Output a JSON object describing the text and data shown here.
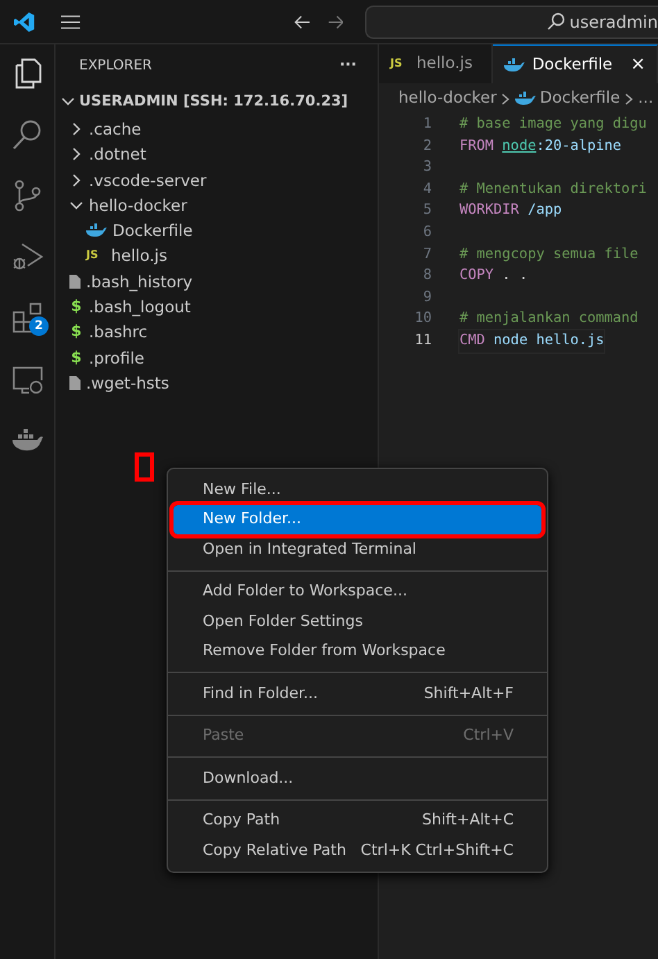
{
  "title_bar": {
    "search": "useradmin"
  },
  "activity_bar": [
    {
      "kind": "files",
      "selected": true
    },
    {
      "kind": "search",
      "selected": false
    },
    {
      "kind": "scm",
      "selected": false
    },
    {
      "kind": "debug",
      "selected": false
    },
    {
      "kind": "extensions",
      "selected": false,
      "badge": "2"
    },
    {
      "kind": "remote",
      "selected": false
    },
    {
      "kind": "docker",
      "selected": false
    }
  ],
  "sidebar": {
    "title": "EXPLORER",
    "more": "···",
    "root": {
      "label": "USERADMIN [SSH: 172.16.70.23]",
      "expanded": true,
      "children": [
        {
          "label": ".cache",
          "kind": "folder",
          "expanded": false
        },
        {
          "label": ".dotnet",
          "kind": "folder",
          "expanded": false
        },
        {
          "label": ".vscode-server",
          "kind": "folder",
          "expanded": false
        },
        {
          "label": "hello-docker",
          "kind": "folder",
          "expanded": true,
          "children": [
            {
              "label": "Dockerfile",
              "kind": "docker"
            },
            {
              "label": "hello.js",
              "kind": "js",
              "icon_text": "JS"
            }
          ]
        },
        {
          "label": ".bash_history",
          "kind": "plain"
        },
        {
          "label": ".bash_logout",
          "kind": "shell",
          "icon_text": "$"
        },
        {
          "label": ".bashrc",
          "kind": "shell",
          "icon_text": "$"
        },
        {
          "label": ".profile",
          "kind": "shell",
          "icon_text": "$"
        },
        {
          "label": ".wget-hsts",
          "kind": "plain"
        }
      ]
    }
  },
  "tabs": [
    {
      "label": "hello.js",
      "kind": "js",
      "icon_text": "JS",
      "selected": false
    },
    {
      "label": "Dockerfile",
      "kind": "docker",
      "selected": true,
      "close": "×"
    }
  ],
  "breadcrumbs": [
    {
      "label": "hello-docker",
      "kind": "folder"
    },
    {
      "label": "Dockerfile",
      "kind": "docker"
    },
    {
      "label": "...",
      "kind": "more"
    }
  ],
  "code": [
    {
      "number": "1",
      "current": false,
      "tokens": [
        {
          "text": "# base image yang digu",
          "kind": "comment"
        }
      ]
    },
    {
      "number": "2",
      "current": false,
      "tokens": [
        {
          "text": "FROM ",
          "kind": "keyword"
        },
        {
          "text": "node",
          "kind": "image"
        },
        {
          "text": ":20-alpine",
          "kind": "variable"
        }
      ]
    },
    {
      "number": "3",
      "current": false
    },
    {
      "number": "4",
      "current": false,
      "tokens": [
        {
          "text": "# Menentukan direktori",
          "kind": "comment"
        }
      ]
    },
    {
      "number": "5",
      "current": false,
      "tokens": [
        {
          "text": "WORKDIR",
          "kind": "keyword"
        },
        {
          "text": " /app",
          "kind": "variable"
        }
      ]
    },
    {
      "number": "6",
      "current": false
    },
    {
      "number": "7",
      "current": false,
      "tokens": [
        {
          "text": "# mengcopy semua file",
          "kind": "comment"
        }
      ]
    },
    {
      "number": "8",
      "current": false,
      "tokens": [
        {
          "text": "COPY",
          "kind": "keyword"
        },
        {
          "text": " . .",
          "kind": "plain"
        }
      ]
    },
    {
      "number": "9",
      "current": false
    },
    {
      "number": "10",
      "current": false,
      "tokens": [
        {
          "text": "# menjalankan command",
          "kind": "comment"
        }
      ]
    },
    {
      "number": "11",
      "current": true,
      "tokens": [
        {
          "text": "CMD",
          "kind": "keyword"
        },
        {
          "text": " node hello.js",
          "kind": "variable"
        }
      ]
    }
  ],
  "context_menu": {
    "items": [
      {
        "kind": "item",
        "label": "New File...",
        "selected": false,
        "disabled": false,
        "annotated": false
      },
      {
        "kind": "item",
        "label": "New Folder...",
        "selected": true,
        "disabled": false,
        "annotated": true
      },
      {
        "kind": "item",
        "label": "Open in Integrated Terminal",
        "selected": false,
        "disabled": false,
        "annotated": false
      },
      {
        "kind": "separator"
      },
      {
        "kind": "item",
        "label": "Add Folder to Workspace...",
        "selected": false,
        "disabled": false,
        "annotated": false
      },
      {
        "kind": "item",
        "label": "Open Folder Settings",
        "selected": false,
        "disabled": false,
        "annotated": false
      },
      {
        "kind": "item",
        "label": "Remove Folder from Workspace",
        "selected": false,
        "disabled": false,
        "annotated": false
      },
      {
        "kind": "separator"
      },
      {
        "kind": "item",
        "label": "Find in Folder...",
        "shortcut": "Shift+Alt+F",
        "selected": false,
        "disabled": false,
        "annotated": false
      },
      {
        "kind": "separator"
      },
      {
        "kind": "item",
        "label": "Paste",
        "shortcut": "Ctrl+V",
        "selected": false,
        "disabled": true,
        "annotated": false
      },
      {
        "kind": "separator"
      },
      {
        "kind": "item",
        "label": "Download...",
        "selected": false,
        "disabled": false,
        "annotated": false
      },
      {
        "kind": "separator"
      },
      {
        "kind": "item",
        "label": "Copy Path",
        "shortcut": "Shift+Alt+C",
        "selected": false,
        "disabled": false,
        "annotated": false
      },
      {
        "kind": "item",
        "label": "Copy Relative Path",
        "shortcut": "Ctrl+K Ctrl+Shift+C",
        "selected": false,
        "disabled": false,
        "annotated": false
      }
    ]
  },
  "marker": {
    "kind": "box"
  }
}
